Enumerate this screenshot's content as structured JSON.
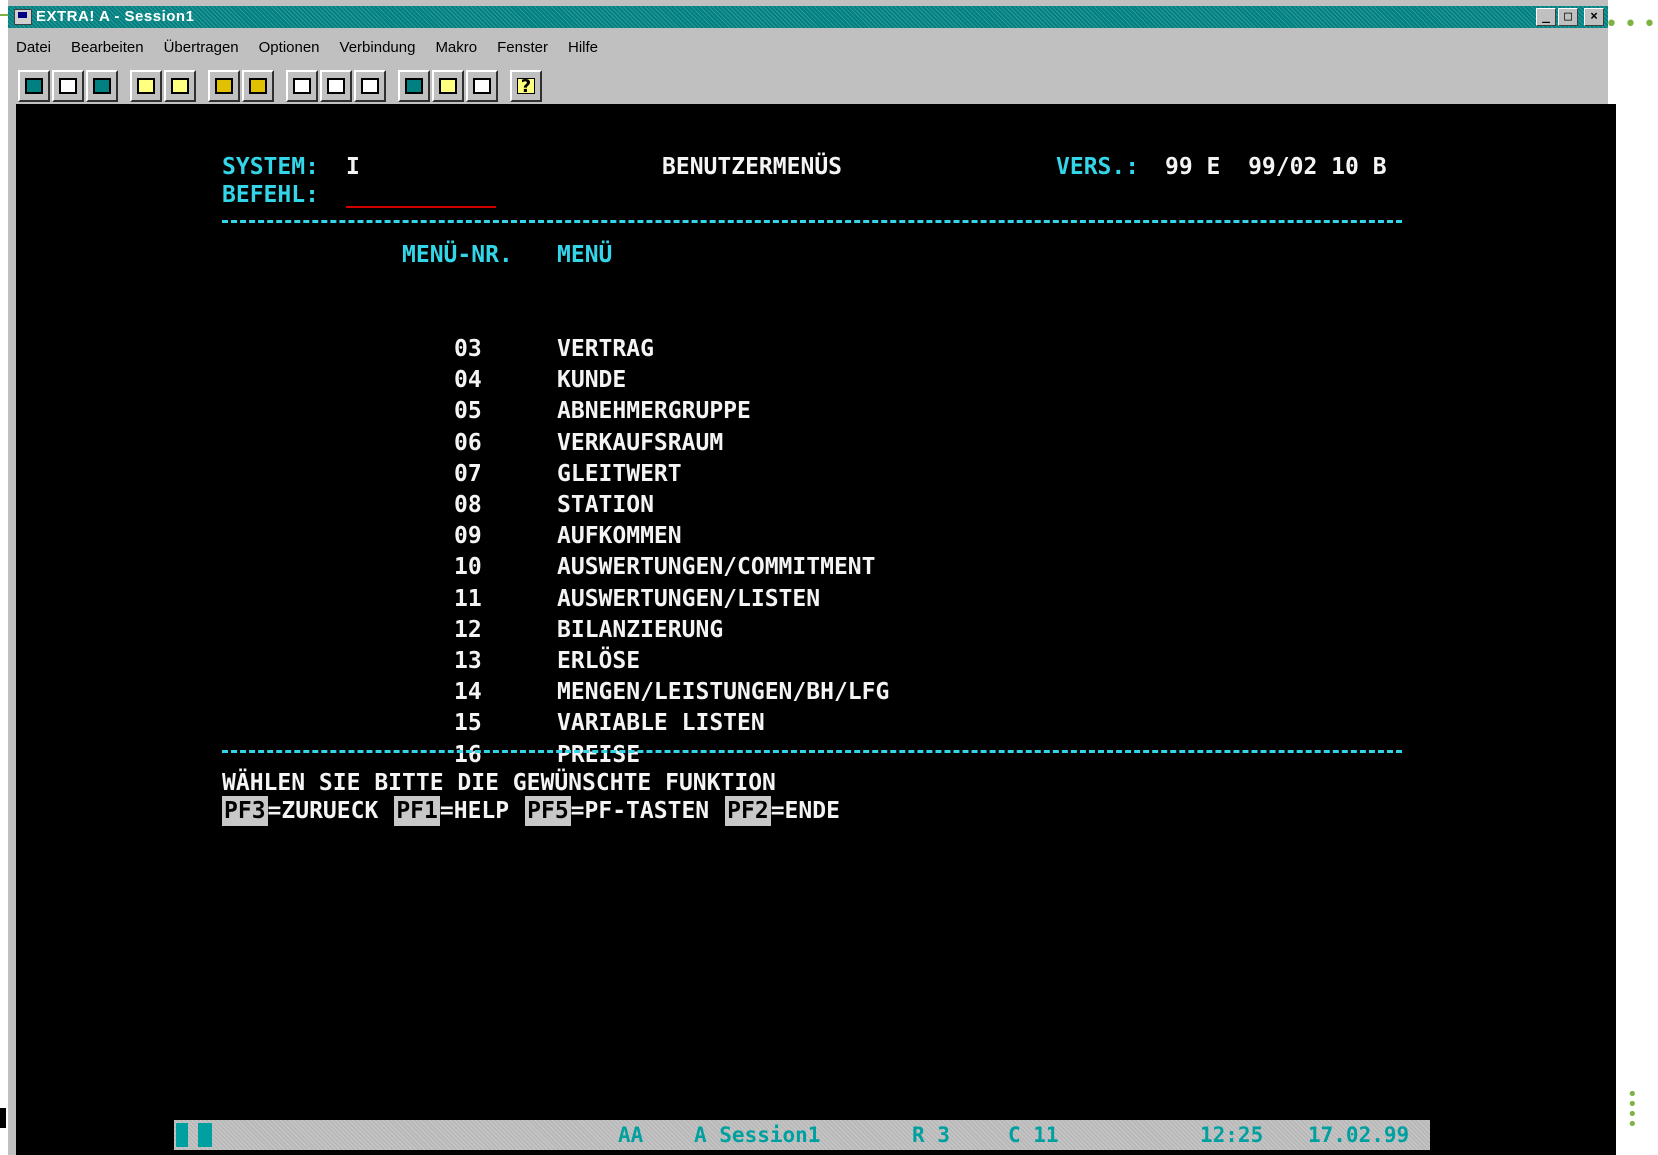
{
  "window": {
    "title": "EXTRA! A - Session1",
    "buttons": {
      "minimize": "_",
      "restore": "□",
      "close": "×"
    }
  },
  "menubar": {
    "items": [
      "Datei",
      "Bearbeiten",
      "Übertragen",
      "Optionen",
      "Verbindung",
      "Makro",
      "Fenster",
      "Hilfe"
    ]
  },
  "toolbar": {
    "groups": [
      [
        "monitor-icon",
        "printer-icon",
        "window-icon"
      ],
      [
        "copy-icon",
        "paste-icon"
      ],
      [
        "folder-open-icon",
        "folder-save-icon"
      ],
      [
        "keyboard-icon",
        "transfer-down-icon",
        "transfer-up-icon"
      ],
      [
        "session-icon",
        "edit-icon",
        "screen-icon"
      ],
      [
        "help-icon"
      ]
    ],
    "help_glyph": "?"
  },
  "screen": {
    "system_label": "SYSTEM:",
    "system_value": "I",
    "title": "BENUTZERMENÜS",
    "version_label": "VERS.:",
    "version_value": "99 E  99/02 10 B",
    "befehl_label": "BEFEHL:",
    "col_nr": "MENÜ-NR.",
    "col_menu": "MENÜ",
    "menu_items": [
      {
        "nr": "03",
        "label": "VERTRAG"
      },
      {
        "nr": "04",
        "label": "KUNDE"
      },
      {
        "nr": "05",
        "label": "ABNEHMERGRUPPE"
      },
      {
        "nr": "06",
        "label": "VERKAUFSRAUM"
      },
      {
        "nr": "07",
        "label": "GLEITWERT"
      },
      {
        "nr": "08",
        "label": "STATION"
      },
      {
        "nr": "09",
        "label": "AUFKOMMEN"
      },
      {
        "nr": "10",
        "label": "AUSWERTUNGEN/COMMITMENT"
      },
      {
        "nr": "11",
        "label": "AUSWERTUNGEN/LISTEN"
      },
      {
        "nr": "12",
        "label": "BILANZIERUNG"
      },
      {
        "nr": "13",
        "label": "ERLÖSE"
      },
      {
        "nr": "14",
        "label": "MENGEN/LEISTUNGEN/BH/LFG"
      },
      {
        "nr": "15",
        "label": "VARIABLE LISTEN"
      },
      {
        "nr": "16",
        "label": "PREISE"
      }
    ],
    "prompt": "WÄHLEN SIE BITTE DIE GEWÜNSCHTE FUNKTION",
    "pfkeys": [
      {
        "key": "PF3",
        "text": "=ZURUECK"
      },
      {
        "key": "PF1",
        "text": "=HELP"
      },
      {
        "key": "PF5",
        "text": "=PF-TASTEN"
      },
      {
        "key": "PF2",
        "text": "=ENDE"
      }
    ]
  },
  "status": {
    "mode": "AA",
    "session": "A Session1",
    "row": "R 3",
    "col": "C 11",
    "time": "12:25",
    "date": "17.02.99"
  },
  "colors": {
    "screen_bg": "#000000",
    "terminal_cyan": "#33d6e8",
    "terminal_white": "#f4f4f4",
    "field_underline": "#d00000",
    "titlebar": "#008080"
  }
}
